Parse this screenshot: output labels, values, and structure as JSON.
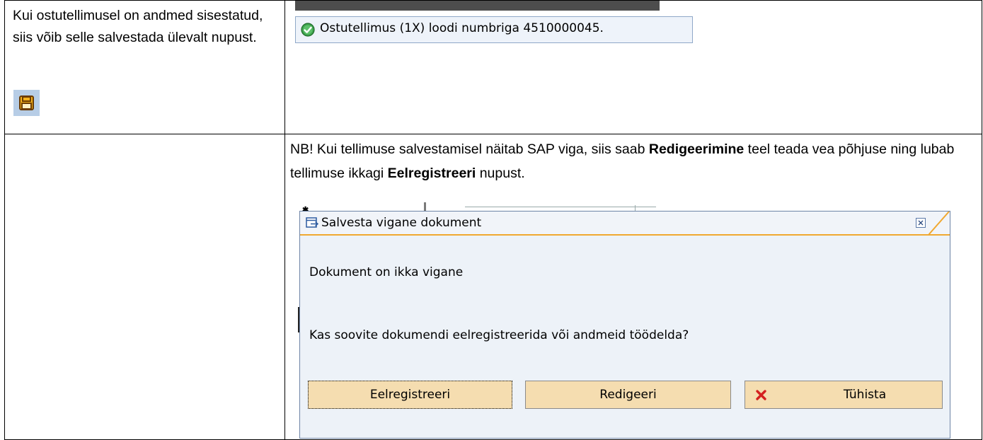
{
  "instruction": {
    "text": "Kui ostutellimusel on andmed sisestatud, siis võib selle salvestada ülevalt nupust.",
    "save_icon": "save-disk-icon"
  },
  "status_bar": {
    "icon": "success-check-icon",
    "message": "Ostutellimus (1X) loodi numbriga 4510000045."
  },
  "note": {
    "part1": "NB! Kui tellimuse salvestamisel näitab SAP viga, siis saab ",
    "bold1": "Redigeerimine",
    "part2": " teel teada vea põhjuse ning lubab tellimuse ikkagi ",
    "bold2": "Eelregistreeri",
    "part3": " nupust."
  },
  "dialog": {
    "title": "Salvesta vigane dokument",
    "message1": "Dokument on ikka vigane",
    "message2": "Kas soovite dokumendi eelregistreerida või andmeid töödelda?",
    "buttons": {
      "preregister": "Eelregistreeri",
      "edit": "Redigeeri",
      "cancel": "Tühista"
    }
  },
  "colors": {
    "accent_orange": "#f0a830",
    "button_fill": "#f5ddb0",
    "status_green": "#3fa34d",
    "cancel_red": "#d42020"
  }
}
